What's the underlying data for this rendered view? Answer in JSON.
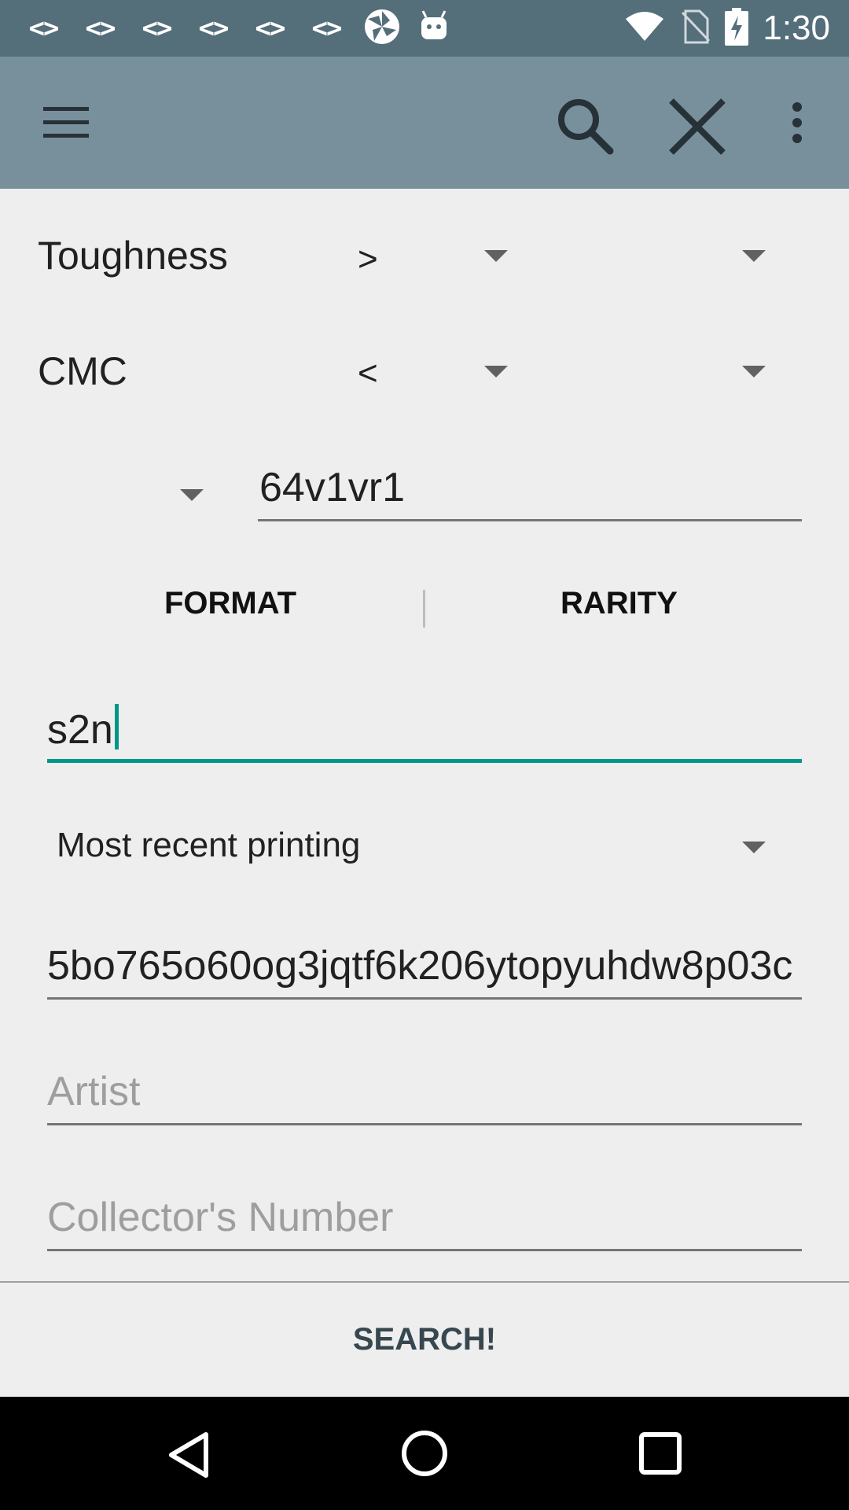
{
  "status_bar": {
    "notification_icons": [
      "<>",
      "<>",
      "<>",
      "<>",
      "<>",
      "<>"
    ],
    "time": "1:30",
    "icons": [
      "code-icon",
      "pinwheel-icon",
      "android-icon",
      "wifi-icon",
      "no-sim-icon",
      "battery-charging-icon"
    ]
  },
  "toolbar": {
    "menu_icon": "hamburger-menu-icon",
    "search_icon": "search-icon",
    "close_icon": "close-icon",
    "overflow_icon": "more-vert-icon"
  },
  "filters": {
    "toughness": {
      "label": "Toughness",
      "operator": ">",
      "value": ""
    },
    "cmc": {
      "label": "CMC",
      "operator": "<",
      "value": ""
    }
  },
  "mana_cost": {
    "dropdown_value": "",
    "text": "64v1vr1"
  },
  "tabs": {
    "format": "FORMAT",
    "rarity": "RARITY"
  },
  "set_field": {
    "value": "s2n"
  },
  "printing": {
    "selected": "Most recent printing"
  },
  "flavor_field": {
    "value": "5bo765o60og3jqtf6k206ytopyuhdw8p03c"
  },
  "artist_field": {
    "placeholder": "Artist"
  },
  "collector_field": {
    "placeholder": "Collector's Number"
  },
  "search_button": {
    "label": "SEARCH!"
  },
  "nav_bar": {
    "icons": [
      "back-icon",
      "home-icon",
      "recents-icon"
    ]
  }
}
